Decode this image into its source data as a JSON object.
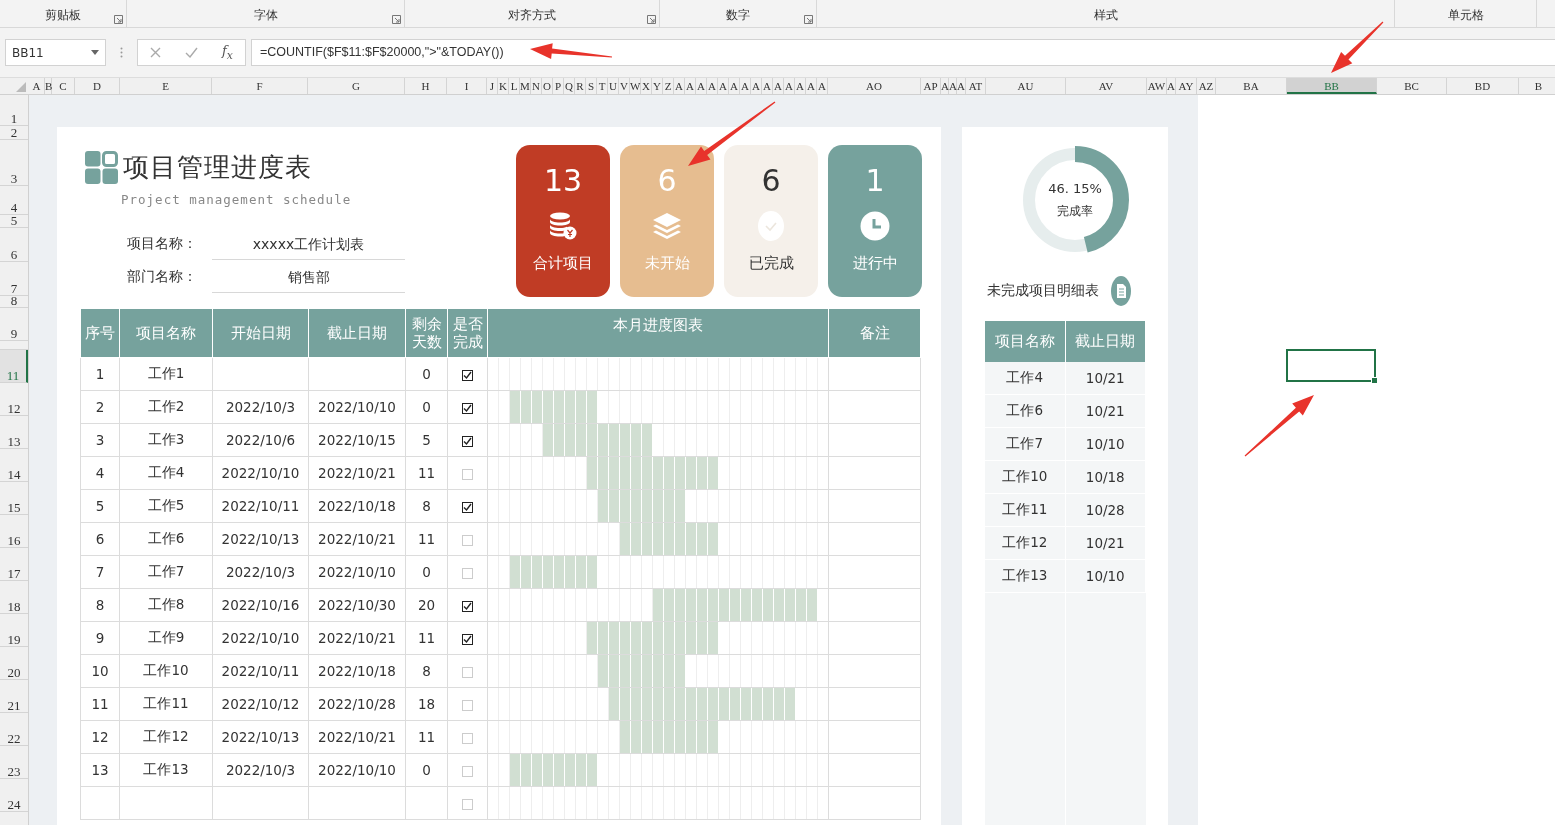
{
  "ribbon": {
    "groups": [
      {
        "label": "剪贴板",
        "launcher": true
      },
      {
        "label": "字体",
        "launcher": true
      },
      {
        "label": "对齐方式",
        "launcher": true
      },
      {
        "label": "数字",
        "launcher": true
      },
      {
        "label": "样式",
        "launcher": false
      },
      {
        "label": "单元格",
        "launcher": false
      }
    ]
  },
  "formula_bar": {
    "name_box": "BB11",
    "fx": "f$_{x}$",
    "formula": "=COUNTIF($F$11:$F$20000,\">\"&TODAY())"
  },
  "column_headers": [
    {
      "label": "A",
      "selected": false
    },
    {
      "label": "B",
      "selected": false
    },
    {
      "label": "C",
      "selected": false
    },
    {
      "label": "D",
      "selected": false
    },
    {
      "label": "E",
      "selected": false
    },
    {
      "label": "F",
      "selected": false
    },
    {
      "label": "G",
      "selected": false
    },
    {
      "label": "H",
      "selected": false
    },
    {
      "label": "I",
      "selected": false
    },
    {
      "label": "J",
      "selected": false
    },
    {
      "label": "K",
      "selected": false
    },
    {
      "label": "L",
      "selected": false
    },
    {
      "label": "M",
      "selected": false
    },
    {
      "label": "N",
      "selected": false
    },
    {
      "label": "O",
      "selected": false
    },
    {
      "label": "P",
      "selected": false
    },
    {
      "label": "Q",
      "selected": false
    },
    {
      "label": "R",
      "selected": false
    },
    {
      "label": "S",
      "selected": false
    },
    {
      "label": "T",
      "selected": false
    },
    {
      "label": "U",
      "selected": false
    },
    {
      "label": "V",
      "selected": false
    },
    {
      "label": "W",
      "selected": false
    },
    {
      "label": "X",
      "selected": false
    },
    {
      "label": "Y",
      "selected": false
    },
    {
      "label": "Z",
      "selected": false
    },
    {
      "label": "A",
      "selected": false
    },
    {
      "label": "A",
      "selected": false
    },
    {
      "label": "A",
      "selected": false
    },
    {
      "label": "A",
      "selected": false
    },
    {
      "label": "A",
      "selected": false
    },
    {
      "label": "A",
      "selected": false
    },
    {
      "label": "A",
      "selected": false
    },
    {
      "label": "A",
      "selected": false
    },
    {
      "label": "A",
      "selected": false
    },
    {
      "label": "A",
      "selected": false
    },
    {
      "label": "A",
      "selected": false
    },
    {
      "label": "A",
      "selected": false
    },
    {
      "label": "A",
      "selected": false
    },
    {
      "label": "A",
      "selected": false
    },
    {
      "label": "AO",
      "selected": false
    },
    {
      "label": "AP",
      "selected": false
    },
    {
      "label": "A",
      "selected": false
    },
    {
      "label": "A",
      "selected": false
    },
    {
      "label": "A",
      "selected": false
    },
    {
      "label": "AT",
      "selected": false
    },
    {
      "label": "AU",
      "selected": false
    },
    {
      "label": "AV",
      "selected": false
    },
    {
      "label": "AW",
      "selected": false
    },
    {
      "label": "A",
      "selected": false
    },
    {
      "label": "AY",
      "selected": false
    },
    {
      "label": "AZ",
      "selected": false
    },
    {
      "label": "BA",
      "selected": false
    },
    {
      "label": "BB",
      "selected": true
    },
    {
      "label": "BC",
      "selected": false
    },
    {
      "label": "BD",
      "selected": false
    },
    {
      "label": "B",
      "selected": false
    }
  ],
  "row_headers": [
    {
      "label": "1",
      "selected": false
    },
    {
      "label": "2",
      "selected": false
    },
    {
      "label": "3",
      "selected": false
    },
    {
      "label": "4",
      "selected": false
    },
    {
      "label": "5",
      "selected": false
    },
    {
      "label": "6",
      "selected": false
    },
    {
      "label": "7",
      "selected": false
    },
    {
      "label": "8",
      "selected": false
    },
    {
      "label": "9",
      "selected": false
    },
    {
      "selected": false
    },
    {
      "label": "11",
      "selected": true
    },
    {
      "label": "12",
      "selected": false
    },
    {
      "label": "13",
      "selected": false
    },
    {
      "label": "14",
      "selected": false
    },
    {
      "label": "15",
      "selected": false
    },
    {
      "label": "16",
      "selected": false
    },
    {
      "label": "17",
      "selected": false
    },
    {
      "label": "18",
      "selected": false
    },
    {
      "label": "19",
      "selected": false
    },
    {
      "label": "20",
      "selected": false
    },
    {
      "label": "21",
      "selected": false
    },
    {
      "label": "22",
      "selected": false
    },
    {
      "label": "23",
      "selected": false
    },
    {
      "label": "24",
      "selected": false
    }
  ],
  "dashboard": {
    "title": "项目管理进度表",
    "subtitle": "Project management schedule",
    "fields": [
      {
        "label": "项目名称：",
        "value": "xxxxx工作计划表"
      },
      {
        "label": "部门名称：",
        "value": "销售部"
      }
    ],
    "stats": [
      {
        "kind": "total",
        "value": "13",
        "label": "合计项目",
        "color": "#c03c25"
      },
      {
        "kind": "not_started",
        "value": "6",
        "label": "未开始",
        "color": "#e6bd90"
      },
      {
        "kind": "done",
        "value": "6",
        "label": "已完成",
        "color": "#f5f0ea"
      },
      {
        "kind": "in_progress",
        "value": "1",
        "label": "进行中",
        "color": "#76a29d"
      }
    ],
    "table": {
      "columns": [
        "序号",
        "项目名称",
        "开始日期",
        "截止日期",
        "剩余天数",
        "是否完成",
        "本月进度图表",
        "备注"
      ],
      "rows": [
        {
          "no": "1",
          "name": "工作1",
          "remaining": "0",
          "done": true
        },
        {
          "no": "2",
          "name": "工作2",
          "start": "2022/10/3",
          "end": "2022/10/10",
          "remaining": "0",
          "done": true
        },
        {
          "no": "3",
          "name": "工作3",
          "start": "2022/10/6",
          "end": "2022/10/15",
          "remaining": "5",
          "done": true
        },
        {
          "no": "4",
          "name": "工作4",
          "start": "2022/10/10",
          "end": "2022/10/21",
          "remaining": "11",
          "done": false
        },
        {
          "no": "5",
          "name": "工作5",
          "start": "2022/10/11",
          "end": "2022/10/18",
          "remaining": "8",
          "done": true
        },
        {
          "no": "6",
          "name": "工作6",
          "start": "2022/10/13",
          "end": "2022/10/21",
          "remaining": "11",
          "done": false
        },
        {
          "no": "7",
          "name": "工作7",
          "start": "2022/10/3",
          "end": "2022/10/10",
          "remaining": "0",
          "done": false
        },
        {
          "no": "8",
          "name": "工作8",
          "start": "2022/10/16",
          "end": "2022/10/30",
          "remaining": "20",
          "done": true
        },
        {
          "no": "9",
          "name": "工作9",
          "start": "2022/10/10",
          "end": "2022/10/21",
          "remaining": "11",
          "done": true
        },
        {
          "no": "10",
          "name": "工作10",
          "start": "2022/10/11",
          "end": "2022/10/18",
          "remaining": "8",
          "done": false
        },
        {
          "no": "11",
          "name": "工作11",
          "start": "2022/10/12",
          "end": "2022/10/28",
          "remaining": "18",
          "done": false
        },
        {
          "no": "12",
          "name": "工作12",
          "start": "2022/10/13",
          "end": "2022/10/21",
          "remaining": "11",
          "done": false
        },
        {
          "no": "13",
          "name": "工作13",
          "start": "2022/10/3",
          "end": "2022/10/10",
          "remaining": "0",
          "done": false
        },
        {
          "done": false
        }
      ]
    }
  },
  "summary": {
    "rate": "46. 15%",
    "rate_label": "完成率",
    "level": 0.4615,
    "title": "未完成项目明细表",
    "columns": [
      "项目名称",
      "截止日期"
    ],
    "rows": [
      {
        "name": "工作4",
        "end": "10/21"
      },
      {
        "name": "工作6",
        "end": "10/21"
      },
      {
        "name": "工作7",
        "end": "10/10"
      },
      {
        "name": "工作10",
        "end": "10/18"
      },
      {
        "name": "工作11",
        "end": "10/28"
      },
      {
        "name": "工作12",
        "end": "10/21"
      },
      {
        "name": "工作13",
        "end": "10/10"
      }
    ]
  }
}
